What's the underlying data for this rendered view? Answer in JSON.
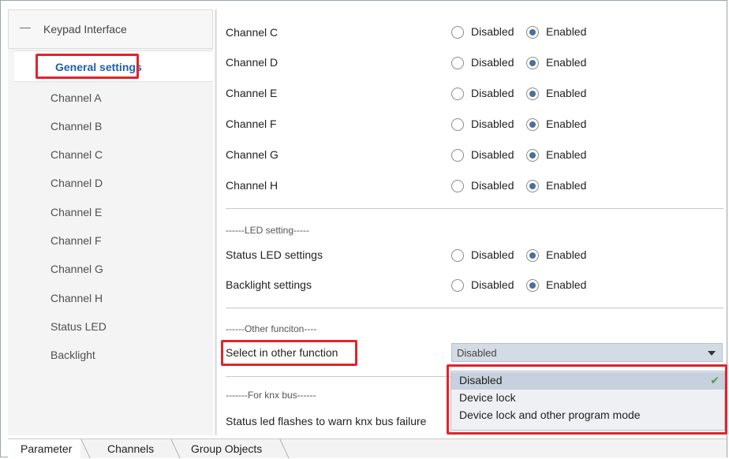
{
  "sidebar": {
    "root_label": "Keypad Interface",
    "selected_label": "General settings",
    "items": [
      "Channel A",
      "Channel B",
      "Channel C",
      "Channel D",
      "Channel E",
      "Channel F",
      "Channel G",
      "Channel H",
      "Status LED",
      "Backlight"
    ]
  },
  "main": {
    "channels": [
      {
        "label": "Channel C",
        "disabled": "Disabled",
        "enabled": "Enabled",
        "value": "Enabled"
      },
      {
        "label": "Channel D",
        "disabled": "Disabled",
        "enabled": "Enabled",
        "value": "Enabled"
      },
      {
        "label": "Channel E",
        "disabled": "Disabled",
        "enabled": "Enabled",
        "value": "Enabled"
      },
      {
        "label": "Channel F",
        "disabled": "Disabled",
        "enabled": "Enabled",
        "value": "Enabled"
      },
      {
        "label": "Channel G",
        "disabled": "Disabled",
        "enabled": "Enabled",
        "value": "Enabled"
      },
      {
        "label": "Channel H",
        "disabled": "Disabled",
        "enabled": "Enabled",
        "value": "Enabled"
      }
    ],
    "led_section": "------LED setting-----",
    "led_rows": [
      {
        "label": "Status LED settings",
        "disabled": "Disabled",
        "enabled": "Enabled",
        "value": "Enabled"
      },
      {
        "label": "Backlight settings",
        "disabled": "Disabled",
        "enabled": "Enabled",
        "value": "Enabled"
      }
    ],
    "other_section": "------Other funciton----",
    "other_label": "Select in other function",
    "other_value": "Disabled",
    "other_options": [
      "Disabled",
      "Device lock",
      "Device lock and other program mode"
    ],
    "knx_section": "-------For knx bus------",
    "knx_label": "Status led flashes to warn knx bus failure"
  },
  "tabs": [
    "Parameter",
    "Channels",
    "Group Objects"
  ],
  "colors": {
    "accent": "#1f5fa8",
    "highlight": "#e0242b",
    "check": "#4aa34a",
    "combo_bg": "#d3dbe4"
  }
}
